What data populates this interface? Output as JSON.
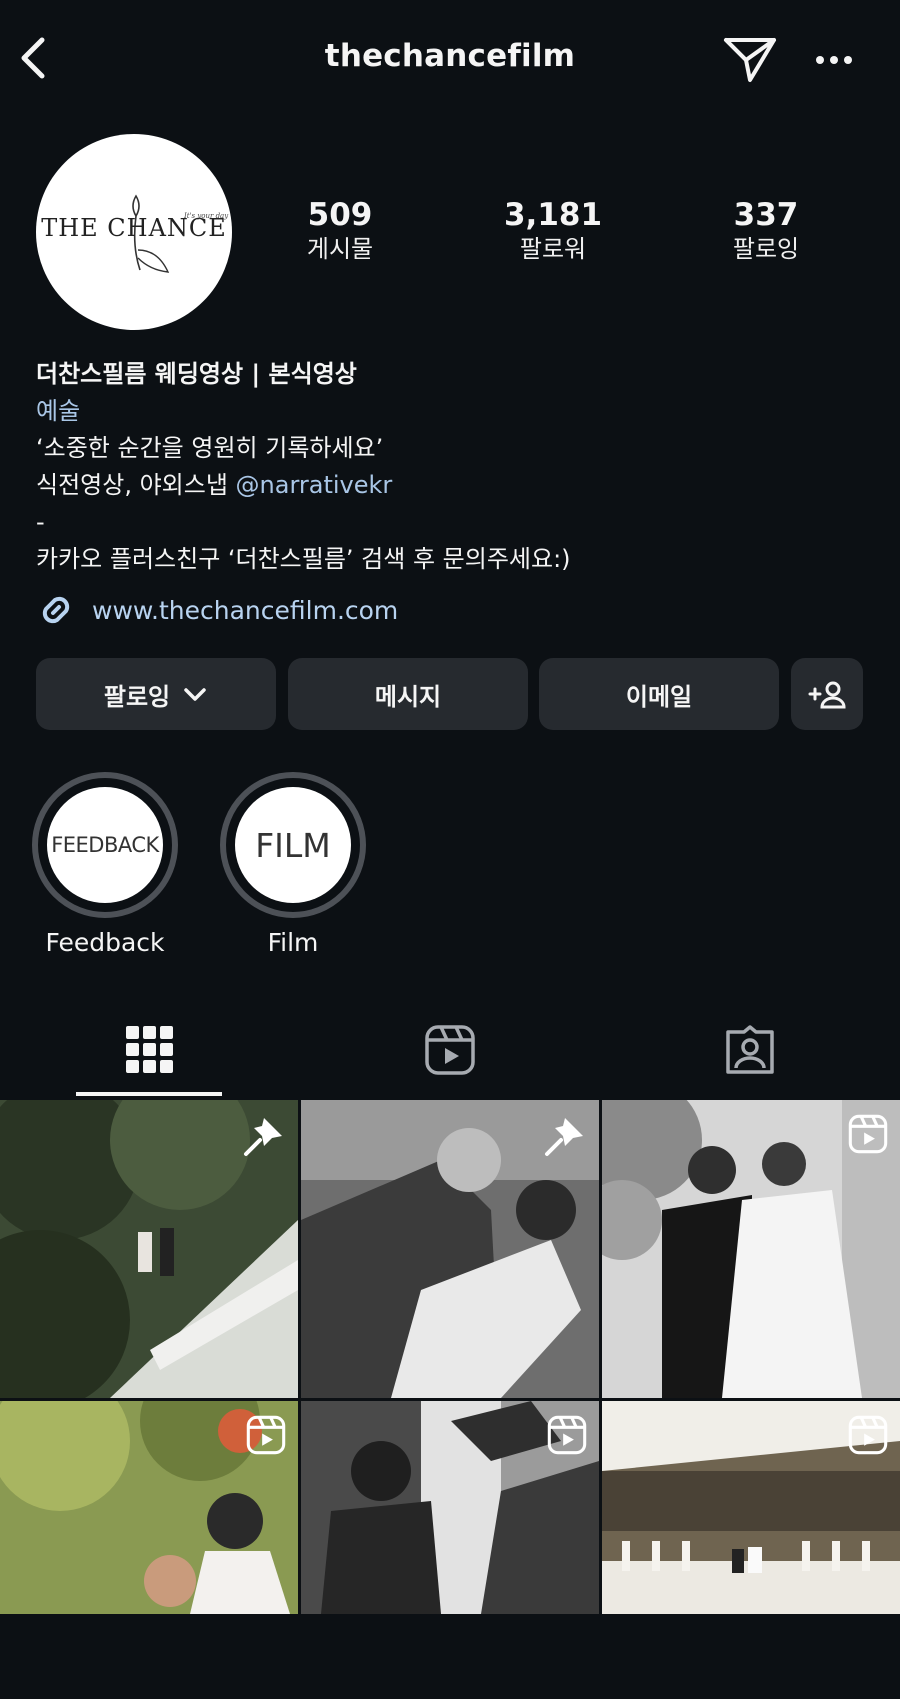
{
  "header": {
    "username": "thechancefilm"
  },
  "profile": {
    "avatar_text": "THE CHANCE",
    "avatar_tagline": "It's your day",
    "stats": [
      {
        "value": "509",
        "label": "게시물"
      },
      {
        "value": "3,181",
        "label": "팔로워"
      },
      {
        "value": "337",
        "label": "팔로잉"
      }
    ],
    "name": "더찬스필름 웨딩영상 | 본식영상",
    "category": "예술",
    "bio_line1": "‘소중한 순간을 영원히 기록하세요’",
    "bio_line2_prefix": "식전영상, 야외스냅 ",
    "bio_line2_mention": "@narrativekr",
    "bio_line3": "-",
    "bio_line4": "카카오 플러스친구 ‘더찬스필름’ 검색 후 문의주세요:)",
    "website": "www.thechancefilm.com"
  },
  "actions": {
    "following": "팔로잉",
    "message": "메시지",
    "email": "이메일"
  },
  "highlights": [
    {
      "cover_text": "FEEDBACK",
      "label": "Feedback"
    },
    {
      "cover_text": "FILM",
      "label": "Film"
    }
  ],
  "tabs": {
    "active": "grid-tab"
  },
  "posts": [
    {
      "badge": "pin-icon",
      "scene": "couple on balcony among trees"
    },
    {
      "badge": "pin-icon",
      "scene": "couple kissing dance dip"
    },
    {
      "badge": "reels-icon",
      "scene": "couple dancing black and white"
    },
    {
      "badge": "reels-icon",
      "scene": "bride cheering outdoors"
    },
    {
      "badge": "reels-icon",
      "scene": "silhouette dance"
    },
    {
      "badge": "reels-icon",
      "scene": "couple on venue balcony"
    }
  ]
}
